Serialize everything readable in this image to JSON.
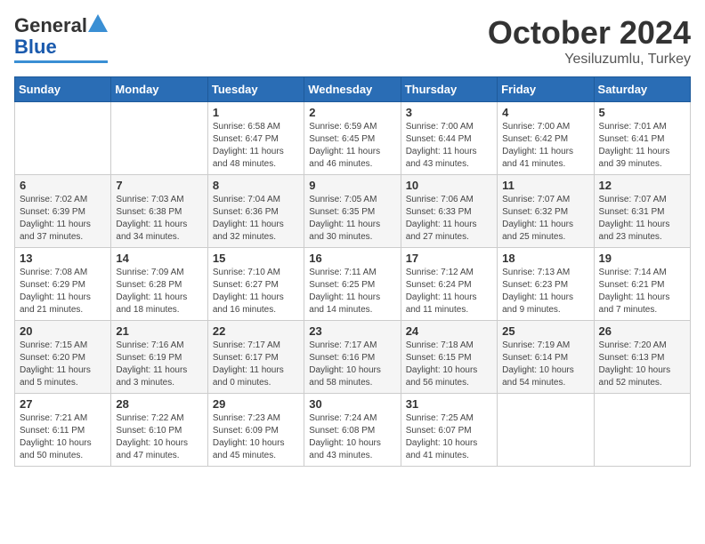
{
  "header": {
    "logo": {
      "general": "General",
      "blue": "Blue"
    },
    "title": "October 2024",
    "location": "Yesiluzumlu, Turkey"
  },
  "calendar": {
    "days_of_week": [
      "Sunday",
      "Monday",
      "Tuesday",
      "Wednesday",
      "Thursday",
      "Friday",
      "Saturday"
    ],
    "weeks": [
      [
        {
          "day": "",
          "info": ""
        },
        {
          "day": "",
          "info": ""
        },
        {
          "day": "1",
          "info": "Sunrise: 6:58 AM\nSunset: 6:47 PM\nDaylight: 11 hours and 48 minutes."
        },
        {
          "day": "2",
          "info": "Sunrise: 6:59 AM\nSunset: 6:45 PM\nDaylight: 11 hours and 46 minutes."
        },
        {
          "day": "3",
          "info": "Sunrise: 7:00 AM\nSunset: 6:44 PM\nDaylight: 11 hours and 43 minutes."
        },
        {
          "day": "4",
          "info": "Sunrise: 7:00 AM\nSunset: 6:42 PM\nDaylight: 11 hours and 41 minutes."
        },
        {
          "day": "5",
          "info": "Sunrise: 7:01 AM\nSunset: 6:41 PM\nDaylight: 11 hours and 39 minutes."
        }
      ],
      [
        {
          "day": "6",
          "info": "Sunrise: 7:02 AM\nSunset: 6:39 PM\nDaylight: 11 hours and 37 minutes."
        },
        {
          "day": "7",
          "info": "Sunrise: 7:03 AM\nSunset: 6:38 PM\nDaylight: 11 hours and 34 minutes."
        },
        {
          "day": "8",
          "info": "Sunrise: 7:04 AM\nSunset: 6:36 PM\nDaylight: 11 hours and 32 minutes."
        },
        {
          "day": "9",
          "info": "Sunrise: 7:05 AM\nSunset: 6:35 PM\nDaylight: 11 hours and 30 minutes."
        },
        {
          "day": "10",
          "info": "Sunrise: 7:06 AM\nSunset: 6:33 PM\nDaylight: 11 hours and 27 minutes."
        },
        {
          "day": "11",
          "info": "Sunrise: 7:07 AM\nSunset: 6:32 PM\nDaylight: 11 hours and 25 minutes."
        },
        {
          "day": "12",
          "info": "Sunrise: 7:07 AM\nSunset: 6:31 PM\nDaylight: 11 hours and 23 minutes."
        }
      ],
      [
        {
          "day": "13",
          "info": "Sunrise: 7:08 AM\nSunset: 6:29 PM\nDaylight: 11 hours and 21 minutes."
        },
        {
          "day": "14",
          "info": "Sunrise: 7:09 AM\nSunset: 6:28 PM\nDaylight: 11 hours and 18 minutes."
        },
        {
          "day": "15",
          "info": "Sunrise: 7:10 AM\nSunset: 6:27 PM\nDaylight: 11 hours and 16 minutes."
        },
        {
          "day": "16",
          "info": "Sunrise: 7:11 AM\nSunset: 6:25 PM\nDaylight: 11 hours and 14 minutes."
        },
        {
          "day": "17",
          "info": "Sunrise: 7:12 AM\nSunset: 6:24 PM\nDaylight: 11 hours and 11 minutes."
        },
        {
          "day": "18",
          "info": "Sunrise: 7:13 AM\nSunset: 6:23 PM\nDaylight: 11 hours and 9 minutes."
        },
        {
          "day": "19",
          "info": "Sunrise: 7:14 AM\nSunset: 6:21 PM\nDaylight: 11 hours and 7 minutes."
        }
      ],
      [
        {
          "day": "20",
          "info": "Sunrise: 7:15 AM\nSunset: 6:20 PM\nDaylight: 11 hours and 5 minutes."
        },
        {
          "day": "21",
          "info": "Sunrise: 7:16 AM\nSunset: 6:19 PM\nDaylight: 11 hours and 3 minutes."
        },
        {
          "day": "22",
          "info": "Sunrise: 7:17 AM\nSunset: 6:17 PM\nDaylight: 11 hours and 0 minutes."
        },
        {
          "day": "23",
          "info": "Sunrise: 7:17 AM\nSunset: 6:16 PM\nDaylight: 10 hours and 58 minutes."
        },
        {
          "day": "24",
          "info": "Sunrise: 7:18 AM\nSunset: 6:15 PM\nDaylight: 10 hours and 56 minutes."
        },
        {
          "day": "25",
          "info": "Sunrise: 7:19 AM\nSunset: 6:14 PM\nDaylight: 10 hours and 54 minutes."
        },
        {
          "day": "26",
          "info": "Sunrise: 7:20 AM\nSunset: 6:13 PM\nDaylight: 10 hours and 52 minutes."
        }
      ],
      [
        {
          "day": "27",
          "info": "Sunrise: 7:21 AM\nSunset: 6:11 PM\nDaylight: 10 hours and 50 minutes."
        },
        {
          "day": "28",
          "info": "Sunrise: 7:22 AM\nSunset: 6:10 PM\nDaylight: 10 hours and 47 minutes."
        },
        {
          "day": "29",
          "info": "Sunrise: 7:23 AM\nSunset: 6:09 PM\nDaylight: 10 hours and 45 minutes."
        },
        {
          "day": "30",
          "info": "Sunrise: 7:24 AM\nSunset: 6:08 PM\nDaylight: 10 hours and 43 minutes."
        },
        {
          "day": "31",
          "info": "Sunrise: 7:25 AM\nSunset: 6:07 PM\nDaylight: 10 hours and 41 minutes."
        },
        {
          "day": "",
          "info": ""
        },
        {
          "day": "",
          "info": ""
        }
      ]
    ]
  }
}
